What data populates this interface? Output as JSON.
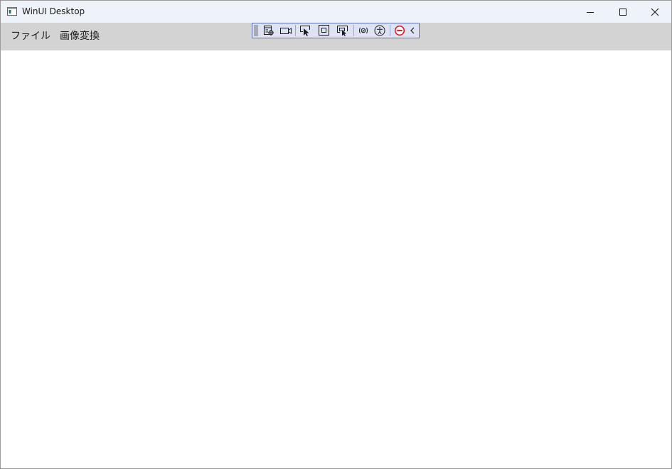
{
  "window": {
    "title": "WinUI Desktop"
  },
  "menubar": {
    "items": [
      {
        "label": "ファイル"
      },
      {
        "label": "画像変換"
      }
    ]
  },
  "devtools_toolbar": {
    "accent_color": "#5b6fb4",
    "icons": [
      "live-visual-tree-icon",
      "video-camera-icon",
      "select-element-icon",
      "display-layout-adorners-icon",
      "track-focus-icon",
      "hot-reload-icon",
      "accessibility-icon",
      "binding-failures-icon",
      "collapse-chevron-icon"
    ]
  }
}
